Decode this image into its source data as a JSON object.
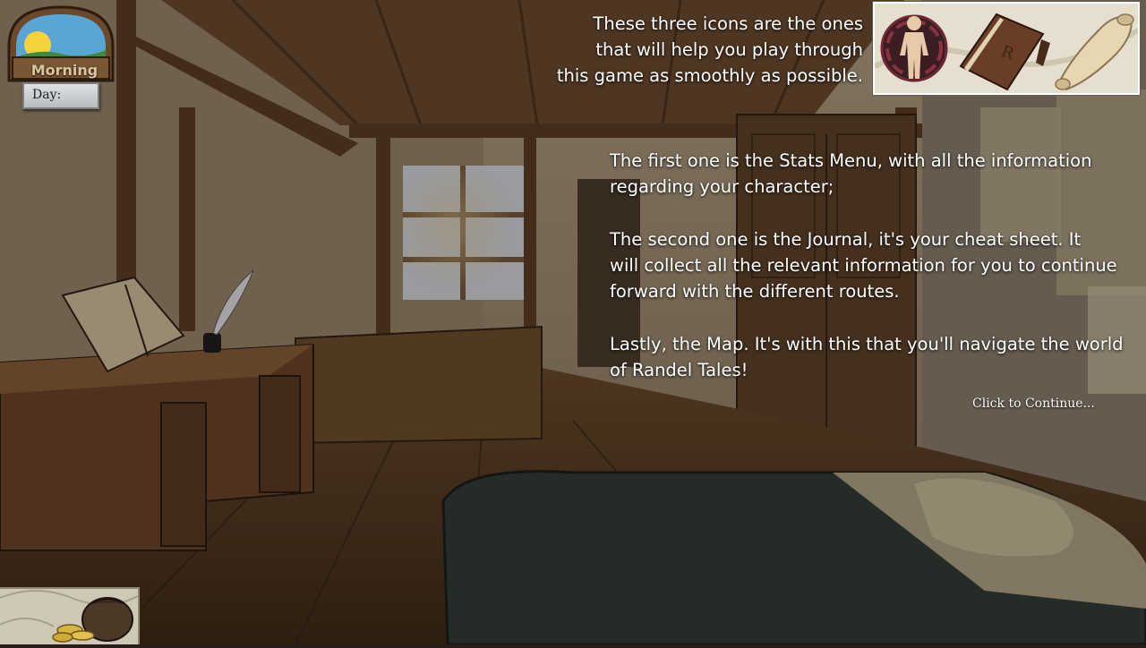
{
  "hud": {
    "time_of_day": "Morning",
    "day_label": "Day:",
    "icons": {
      "sun": "sun-icon",
      "coin_bag": "coin-bag-icon"
    }
  },
  "tutorial": {
    "intro_lines": [
      "These three icons are the ones",
      "that will help you play through",
      "this game as smoothly as possible."
    ],
    "icons": [
      {
        "name": "stats-menu-icon",
        "label": "Stats Menu"
      },
      {
        "name": "journal-icon",
        "label": "Journal"
      },
      {
        "name": "map-icon",
        "label": "Map"
      }
    ],
    "paragraphs": [
      "The first one is the Stats Menu, with all the information\nregarding your character;",
      "The second one is the Journal, it's your cheat sheet. It\nwill collect all the relevant information for you to continue\nforward with the different routes.",
      "Lastly, the Map. It's with this that you'll navigate the world\nof Randel Tales!"
    ],
    "continue_prompt": "Click to Continue..."
  },
  "colors": {
    "text": "#ffffff",
    "panel_border": "#ffffff",
    "wood": "#6b4a2c"
  }
}
